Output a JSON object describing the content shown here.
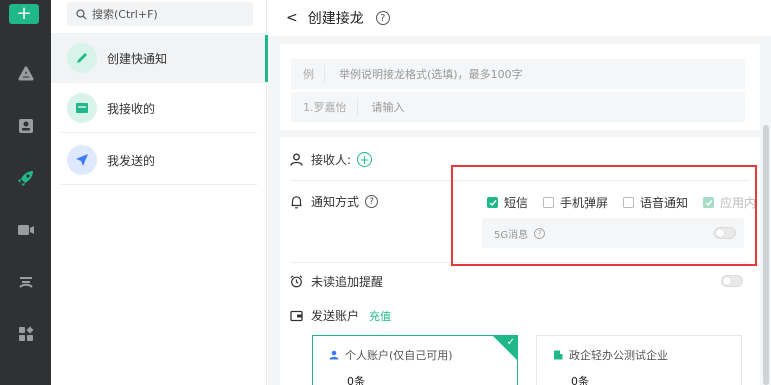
{
  "rail": {
    "add_label": "+",
    "icons": [
      "logo-icon",
      "contacts-icon",
      "rocket-icon",
      "video-icon",
      "cloud-icon",
      "apps-icon"
    ]
  },
  "sidebar": {
    "search_placeholder": "搜索(Ctrl+F)",
    "items": [
      {
        "label": "创建快通知",
        "icon": "pencil-icon",
        "color": "#21b889"
      },
      {
        "label": "我接收的",
        "icon": "inbox-icon",
        "color": "#21b889"
      },
      {
        "label": "我发送的",
        "icon": "send-icon",
        "color": "#3b7bf6"
      }
    ]
  },
  "header": {
    "back": "<",
    "title": "创建接龙",
    "help": "?"
  },
  "form": {
    "example_prefix": "例",
    "example_placeholder": "举例说明接龙格式(选填)，最多100字",
    "entry_prefix": "1.罗嘉怡",
    "entry_placeholder": "请输入",
    "receiver_label": "接收人:",
    "notify_label": "通知方式",
    "options": [
      {
        "label": "短信",
        "checked": true,
        "disabled": false
      },
      {
        "label": "手机弹屏",
        "checked": false,
        "disabled": false
      },
      {
        "label": "语音通知",
        "checked": false,
        "disabled": false
      },
      {
        "label": "应用内",
        "checked": true,
        "disabled": true
      }
    ],
    "g5_label": "5G消息",
    "unread_label": "未读追加提醒",
    "account_label": "发送账户",
    "recharge_label": "充值"
  },
  "accounts": [
    {
      "name": "个人账户(仅自己可用)",
      "count": "0条",
      "selected": true
    },
    {
      "name": "政企轻办公测试企业",
      "count": "0条",
      "selected": false
    }
  ],
  "colors": {
    "accent": "#21b889",
    "highlight_box": "#e23b3b",
    "rail": "#2f3133"
  }
}
